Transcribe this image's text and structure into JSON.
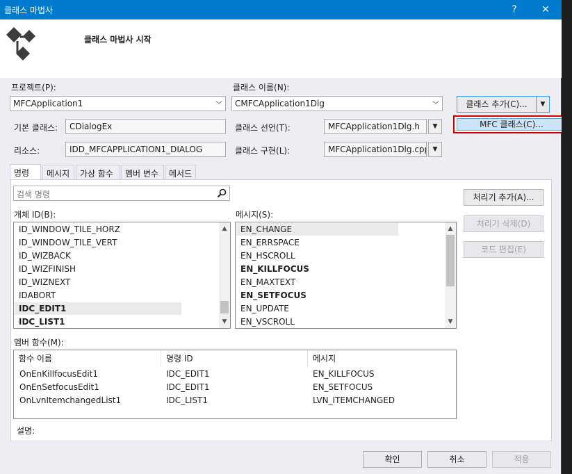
{
  "window": {
    "title": "클래스 마법사",
    "help_glyph": "?",
    "close_glyph": "✕"
  },
  "header": {
    "title": "클래스 마법사 시작"
  },
  "project": {
    "label": "프로젝트(P):",
    "value": "MFCApplication1"
  },
  "class_name": {
    "label": "클래스 이름(N):",
    "value": "CMFCApplication1Dlg"
  },
  "add_class": {
    "label": "클래스 추가(C)...",
    "menu_item": "MFC 클래스(C)..."
  },
  "base_class": {
    "label": "기본 클래스:",
    "value": "CDialogEx"
  },
  "class_decl": {
    "label": "클래스 선언(T):",
    "value": "MFCApplication1Dlg.h"
  },
  "resource": {
    "label": "리소스:",
    "value": "IDD_MFCAPPLICATION1_DIALOG"
  },
  "class_impl": {
    "label": "클래스 구현(L):",
    "value": "MFCApplication1Dlg.cpp"
  },
  "tabs": [
    {
      "label": "명령"
    },
    {
      "label": "메시지"
    },
    {
      "label": "가상 함수"
    },
    {
      "label": "멤버 변수"
    },
    {
      "label": "메서드"
    }
  ],
  "search": {
    "placeholder": "검색 명령"
  },
  "object_ids": {
    "label": "개체 ID(B):",
    "items": [
      {
        "text": "ID_WINDOW_TILE_HORZ",
        "bold": false
      },
      {
        "text": "ID_WINDOW_TILE_VERT",
        "bold": false
      },
      {
        "text": "ID_WIZBACK",
        "bold": false
      },
      {
        "text": "ID_WIZFINISH",
        "bold": false
      },
      {
        "text": "ID_WIZNEXT",
        "bold": false
      },
      {
        "text": "IDABORT",
        "bold": false
      },
      {
        "text": "IDC_EDIT1",
        "bold": true
      },
      {
        "text": "IDC_LIST1",
        "bold": true
      }
    ]
  },
  "messages": {
    "label": "메시지(S):",
    "items": [
      {
        "text": "EN_CHANGE",
        "bold": false
      },
      {
        "text": "EN_ERRSPACE",
        "bold": false
      },
      {
        "text": "EN_HSCROLL",
        "bold": false
      },
      {
        "text": "EN_KILLFOCUS",
        "bold": true
      },
      {
        "text": "EN_MAXTEXT",
        "bold": false
      },
      {
        "text": "EN_SETFOCUS",
        "bold": true
      },
      {
        "text": "EN_UPDATE",
        "bold": false
      },
      {
        "text": "EN_VSCROLL",
        "bold": false
      }
    ]
  },
  "side_buttons": {
    "add_handler": "처리기 추가(A)...",
    "delete_handler": "처리기 삭제(D)",
    "edit_code": "코드 편집(E)"
  },
  "member_functions": {
    "label": "멤버 함수(M):",
    "columns": [
      "함수 이름",
      "명령 ID",
      "메시지"
    ],
    "rows": [
      [
        "OnEnKillfocusEdit1",
        "IDC_EDIT1",
        "EN_KILLFOCUS"
      ],
      [
        "OnEnSetfocusEdit1",
        "IDC_EDIT1",
        "EN_SETFOCUS"
      ],
      [
        "OnLvnItemchangedList1",
        "IDC_LIST1",
        "LVN_ITEMCHANGED"
      ]
    ]
  },
  "description": {
    "label": "설명:"
  },
  "footer": {
    "ok": "확인",
    "cancel": "취소",
    "apply": "적용"
  }
}
